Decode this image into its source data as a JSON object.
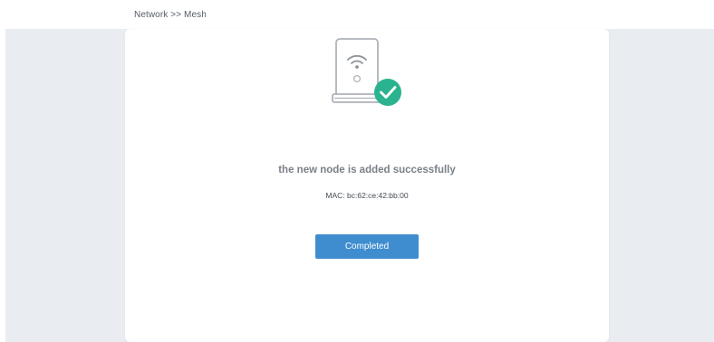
{
  "header": {
    "breadcrumb": "Network >> Mesh"
  },
  "status": {
    "title": "the new node is added successfully",
    "mac": "MAC: bc:62:ce:42:bb:00"
  },
  "actions": {
    "complete_label": "Completed"
  },
  "colors": {
    "accent": "#3f8dcf",
    "success": "#2bb38f",
    "page_background": "#e9ecf0",
    "card_background": "#ffffff"
  },
  "icons": {
    "illustration": "router-icon",
    "check": "check-circle-icon"
  }
}
